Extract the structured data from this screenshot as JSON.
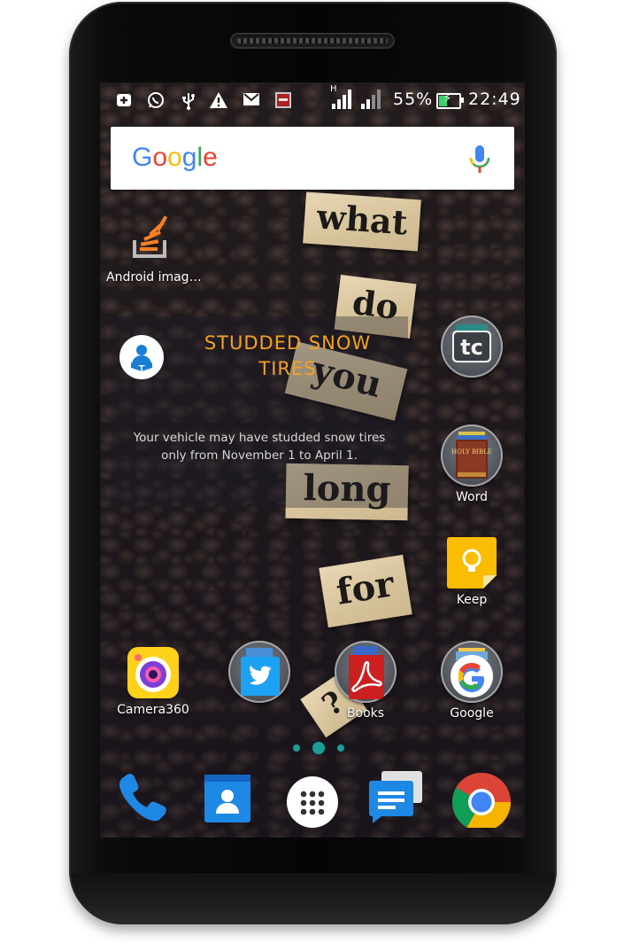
{
  "status_bar": {
    "icons": [
      "plus-icon",
      "whatsapp-icon",
      "usb-icon",
      "warning-icon",
      "gmail-icon",
      "app-notification-icon"
    ],
    "network_label": "H",
    "battery_percent": "55%",
    "time": "22:49"
  },
  "google_search": {
    "logo_letters": [
      {
        "char": "G",
        "color": "#4285F4"
      },
      {
        "char": "o",
        "color": "#EA4335"
      },
      {
        "char": "o",
        "color": "#FBBC05"
      },
      {
        "char": "g",
        "color": "#4285F4"
      },
      {
        "char": "l",
        "color": "#34A853"
      },
      {
        "char": "e",
        "color": "#EA4335"
      }
    ],
    "mic_icon": "microphone-icon"
  },
  "wallpaper_words": [
    "what",
    "do",
    "you",
    "long",
    "for",
    "?"
  ],
  "widget": {
    "title": "STUDDED SNOW TIRES",
    "body_line1": "Your vehicle may have studded snow tires",
    "body_line2": "only from November 1 to April 1."
  },
  "apps": {
    "android_images": "Android imag…",
    "tc_app": "",
    "word": "Word",
    "keep": "Keep",
    "camera360": "Camera360",
    "twitter": "",
    "books": "Books",
    "google": "Google"
  },
  "icon_texts": {
    "tc": "tc",
    "bible": "HOLY BIBLE"
  },
  "page_indicator": {
    "pages": 3,
    "current": 2
  },
  "dock": [
    "phone-icon",
    "contacts-icon",
    "app-drawer-icon",
    "messages-icon",
    "chrome-icon"
  ],
  "colors": {
    "widget_title": "#f5a223",
    "page_dot": "#1a9e95"
  }
}
